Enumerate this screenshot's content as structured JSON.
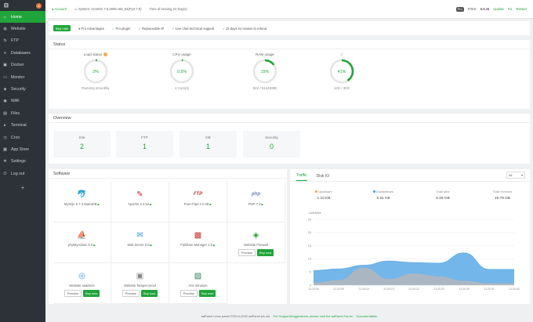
{
  "sidebar": {
    "logo": "⊡",
    "badge": "8",
    "items": [
      {
        "label": "Home",
        "icon": "home-icon",
        "glyph": "⌂"
      },
      {
        "label": "Website",
        "icon": "globe-icon",
        "glyph": "◍"
      },
      {
        "label": "FTP",
        "icon": "ftp-icon",
        "glyph": "⇅"
      },
      {
        "label": "Databases",
        "icon": "database-icon",
        "glyph": "≡"
      },
      {
        "label": "Docker",
        "icon": "docker-icon",
        "glyph": "▣"
      },
      {
        "label": "Monitor",
        "icon": "monitor-icon",
        "glyph": "▭"
      },
      {
        "label": "Security",
        "icon": "shield-icon",
        "glyph": "◈"
      },
      {
        "label": "WAF",
        "icon": "waf-icon",
        "glyph": "◉"
      },
      {
        "label": "Files",
        "icon": "folder-icon",
        "glyph": "▤"
      },
      {
        "label": "Terminal",
        "icon": "terminal-icon",
        "glyph": "▸"
      },
      {
        "label": "Cron",
        "icon": "clock-icon",
        "glyph": "◷"
      },
      {
        "label": "App Store",
        "icon": "app-store-icon",
        "glyph": "▦"
      },
      {
        "label": "Settings",
        "icon": "gear-icon",
        "glyph": "✲"
      },
      {
        "label": "Log out",
        "icon": "logout-icon",
        "glyph": "⏻"
      }
    ],
    "add": "+"
  },
  "topbar": {
    "account": "Account",
    "system": "System:  CentOS 7.9.2009 x86_64(Py3.7.9)",
    "uptime": "Time of running 24 Day(s)",
    "pro_badge": "Pro",
    "free_label": "FREE",
    "version": "6.8.26",
    "update": "Update",
    "fix": "Fix",
    "restart": "Restart"
  },
  "features": {
    "buy_now": "Buy now",
    "pro_adv": "Pro Advantages",
    "items": [
      "Pro plugin",
      "Replaceable IP",
      "Live chat technical support",
      "15 days no reason to refund"
    ]
  },
  "status": {
    "title": "Status",
    "gauges": [
      {
        "label": "Load status",
        "value": "2%",
        "pct": 2,
        "sub": "Running smoothly",
        "warn": true
      },
      {
        "label": "CPU usage",
        "value": "0.5%",
        "pct": 0.5,
        "sub": "4 Core(s)",
        "warn": false
      },
      {
        "label": "RAM usage",
        "value": "15%",
        "pct": 15,
        "sub": "922 / 6144(MB)",
        "warn": false
      },
      {
        "label": "/",
        "value": "41%",
        "pct": 41,
        "sub": "12G / 30G",
        "warn": false
      }
    ]
  },
  "overview": {
    "title": "Overview",
    "cards": [
      {
        "label": "Site",
        "value": "2"
      },
      {
        "label": "FTP",
        "value": "1"
      },
      {
        "label": "DB",
        "value": "1"
      },
      {
        "label": "Security",
        "value": "0"
      }
    ]
  },
  "software": {
    "title": "Software",
    "preview": "Preview",
    "buy": "Buy now",
    "items": [
      {
        "name": "MySQL 5.7.3 MariaDB",
        "glyph": "🐬",
        "color": "#3a7fb8",
        "buttons": false
      },
      {
        "name": "Apache 2.4.54",
        "glyph": "✎",
        "color": "#c8232c",
        "buttons": false
      },
      {
        "name": "Pure-Ftpd 1.0.49",
        "glyph": "FTP",
        "color": "#c0392b",
        "buttons": false
      },
      {
        "name": "PHP-7.4",
        "glyph": "php",
        "color": "#6f7cba",
        "buttons": false
      },
      {
        "name": "phpMyAdmin 5.0",
        "glyph": "⛵",
        "color": "#e8a23a",
        "buttons": false
      },
      {
        "name": "Mail Server 6.6",
        "glyph": "✉",
        "color": "#3a9ad9",
        "buttons": false
      },
      {
        "name": "Fail2ban Manager 1.0",
        "glyph": "▩",
        "color": "#c0392b",
        "buttons": false
      },
      {
        "name": "Website Firewall",
        "glyph": "◈",
        "color": "#20a53a",
        "buttons": true
      },
      {
        "name": "Website statistics",
        "glyph": "◎",
        "color": "#3a9ad9",
        "buttons": true
      },
      {
        "name": "Website Tamper-proof",
        "glyph": "▣",
        "color": "#888888",
        "buttons": true
      },
      {
        "name": "Anti intrusion",
        "glyph": "▨",
        "color": "#2e7d5a",
        "buttons": true
      }
    ]
  },
  "traffic": {
    "tabs": [
      "Traffic",
      "Disk IO"
    ],
    "select": "All",
    "stats": [
      {
        "label": "Upstream",
        "value": "1.10 KB",
        "dot": "#f3a83b"
      },
      {
        "label": "Downstream",
        "value": "5.91 KB",
        "dot": "#3a9ad9"
      },
      {
        "label": "Total sent",
        "value": "5.29 GB",
        "dot": ""
      },
      {
        "label": "Total received",
        "value": "19.79 GB",
        "dot": ""
      }
    ]
  },
  "chart_data": {
    "type": "area",
    "ylabel": "Unit:KB/s",
    "ylim": [
      0,
      25
    ],
    "yticks": [
      0,
      5,
      10,
      15,
      20,
      25
    ],
    "x": [
      "21:20:06",
      "21:20:09",
      "21:20:16",
      "21:20:19",
      "21:20:22",
      "21:20:25",
      "21:20:28",
      "21:20:31",
      "21:20:33"
    ],
    "series": [
      {
        "name": "Downstream",
        "color": "#5aa9e6",
        "values": [
          5.6,
          6.2,
          7.6,
          9.2,
          8.6,
          8.4,
          12.3,
          6.0,
          6.0
        ]
      },
      {
        "name": "Upstream",
        "color": "#b8b8b8",
        "values": [
          0.8,
          1.8,
          6.5,
          2.2,
          4.3,
          3.2,
          1.5,
          0.6,
          0.6
        ]
      }
    ]
  },
  "footer": {
    "copyright": "aaPanel Linux panel ©2014-2022 aaPanel (bt.cn)",
    "support": "For Support|Suggestions, please visit the aaPanel Forum",
    "docs": "Documentation"
  }
}
